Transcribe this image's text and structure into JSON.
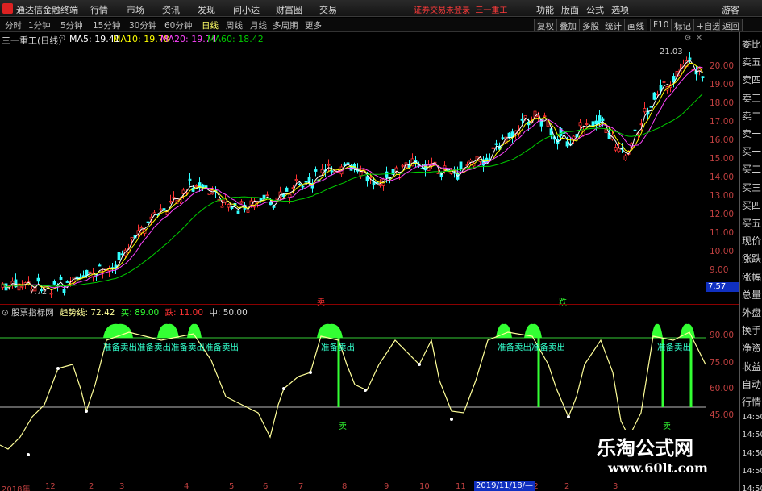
{
  "menubar": {
    "app_title": "通达信金融终端",
    "items": [
      "行情",
      "市场",
      "资讯",
      "发现",
      "问小达",
      "财富圈",
      "交易"
    ],
    "login_status": "证券交易未登录",
    "stock_name": "三一重工",
    "right_items": [
      "功能",
      "版面",
      "公式",
      "选项"
    ],
    "guest": "游客"
  },
  "toolbar": {
    "periods": [
      "分时",
      "1分钟",
      "5分钟",
      "15分钟",
      "30分钟",
      "60分钟",
      "日线",
      "周线",
      "月线",
      "多周期",
      "更多"
    ],
    "active_period": "日线",
    "buttons": [
      "复权",
      "叠加",
      "多股",
      "统计",
      "画线",
      "F10",
      "标记",
      "+自选",
      "返回"
    ]
  },
  "chart_header": {
    "title": "三一重工(日线)",
    "ma": [
      {
        "label": "MA5: 19.41",
        "color": "#ffffff"
      },
      {
        "label": "MA10: 19.78",
        "color": "#ffff00"
      },
      {
        "label": "MA20: 19.74",
        "color": "#ff44ff"
      },
      {
        "label": "MA60: 18.42",
        "color": "#00cc00"
      }
    ]
  },
  "quote_panel": [
    "委比",
    "卖五",
    "卖四",
    "卖三",
    "卖二",
    "卖一",
    "买一",
    "买二",
    "买三",
    "买四",
    "买五",
    "现价",
    "涨跌",
    "涨幅",
    "总量",
    "外盘",
    "换手",
    "净资",
    "收益",
    "自动",
    "行情",
    "14:50",
    "14:50",
    "14:50",
    "14:50",
    "14:50",
    "14:50"
  ],
  "price_axis": {
    "ticks": [
      "20.00",
      "19.00",
      "18.00",
      "17.00",
      "16.00",
      "15.00",
      "14.00",
      "13.00",
      "12.00",
      "11.00",
      "10.00",
      "9.00"
    ],
    "last_price": "7.57"
  },
  "annotations": {
    "high": "21.03",
    "low": "7.72",
    "mark_down": "跌",
    "mark_sell": "卖"
  },
  "indicator": {
    "name": "股票指标网",
    "trend": "趋势线: 72.42",
    "buy": "买: 89.00",
    "sell": "跌: 11.00",
    "mid": "中: 50.00",
    "ticks": [
      "90.00",
      "75.00",
      "60.00",
      "45.00"
    ],
    "signal_label": "准备卖出",
    "sell_label": "卖"
  },
  "time_axis": {
    "ticks": [
      "2018年",
      "12",
      "2",
      "3",
      "4",
      "5",
      "6",
      "7",
      "8",
      "9",
      "10",
      "11",
      "12",
      "2",
      "3"
    ],
    "cursor_date": "2019/11/18/—"
  },
  "watermark": {
    "title": "乐淘公式网",
    "url": "www.60lt.com"
  },
  "colors": {
    "up": "#ff3333",
    "down": "#33ffff",
    "ma5": "#ffffff",
    "ma10": "#ffff00",
    "ma20": "#ff44ff",
    "ma60": "#00cc00",
    "trend": "#ffff99",
    "signal": "#33ff33"
  }
}
